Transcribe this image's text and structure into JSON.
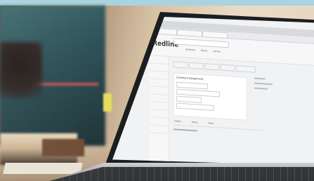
{
  "scene": {
    "description_items": []
  },
  "screen": {
    "logo": "Redline",
    "nav": [
      "Dashboard",
      "Reports",
      "Settings"
    ],
    "sidebar_items": [
      "",
      "",
      "",
      "",
      "",
      "",
      "",
      "",
      "",
      "",
      "",
      ""
    ],
    "card_title": "Comment Assignment",
    "tabs": [
      "Details",
      "History",
      "Notes"
    ]
  },
  "colors": {
    "sky": "#a9d3de",
    "book": "#2b4e55",
    "stripe": "#d4574f",
    "laptop": "#1c1d20",
    "screen": "#f1f2f3"
  }
}
